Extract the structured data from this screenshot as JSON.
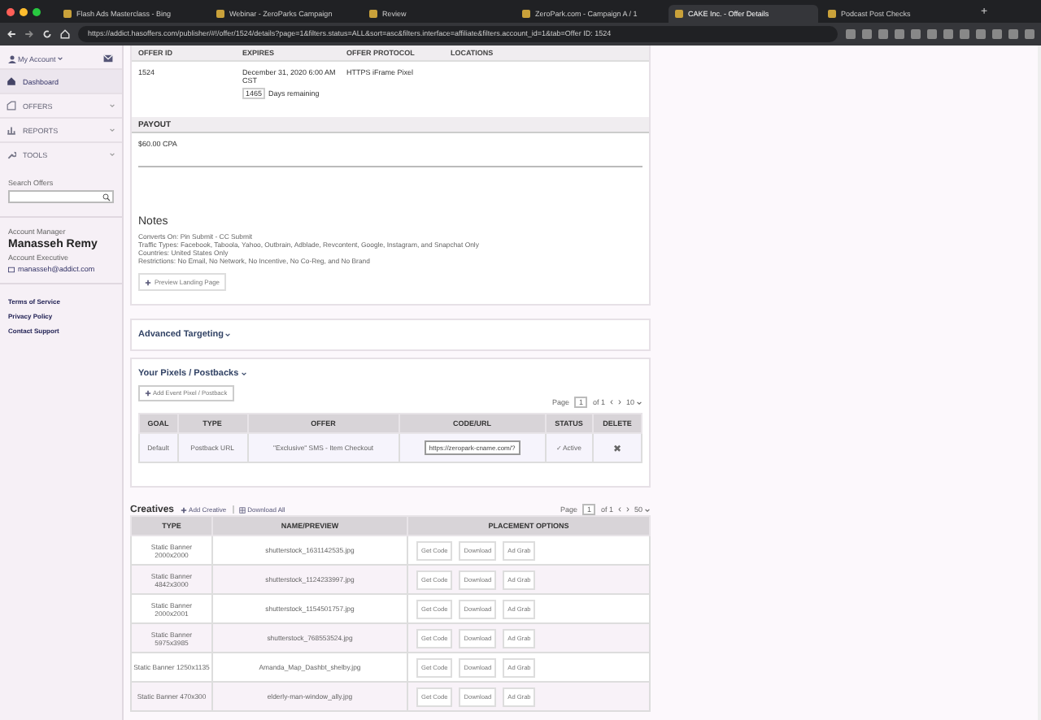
{
  "browser": {
    "tabs": [
      {
        "title": "Flash Ads Masterclass - Bing",
        "selected": false
      },
      {
        "title": "Webinar - ZeroParks Campaign",
        "selected": false
      },
      {
        "title": "Review",
        "selected": false
      },
      {
        "title": "ZeroPark.com - Campaign A / 1",
        "selected": false
      },
      {
        "title": "CAKE Inc. - Offer Details",
        "selected": true
      },
      {
        "title": "Podcast Post Checks",
        "selected": false
      }
    ],
    "new_tab": "+",
    "url": "https://addict.hasoffers.com/publisher/#!/offer/1524/details?page=1&filters.status=ALL&sort=asc&filters.interface=affiliate&filters.account_id=1&tab=Offer ID: 1524"
  },
  "sidebar": {
    "account": "My Account",
    "nav": [
      {
        "label": "Dashboard",
        "kind": "home",
        "expandable": false,
        "selected": true
      },
      {
        "label": "OFFERS",
        "kind": "offers",
        "expandable": true,
        "selected": false
      },
      {
        "label": "REPORTS",
        "kind": "reports",
        "expandable": true,
        "selected": false
      },
      {
        "label": "TOOLS",
        "kind": "tools",
        "expandable": true,
        "selected": false
      }
    ],
    "search_label": "Search Offers",
    "manager": {
      "heading": "Account Manager",
      "name": "Manasseh Remy",
      "title": "Account Executive",
      "email": "manasseh@addict.com"
    },
    "links": [
      "Terms of Service",
      "Privacy Policy",
      "Contact Support"
    ]
  },
  "offer": {
    "columns": [
      "OFFER ID",
      "EXPIRES",
      "OFFER PROTOCOL",
      "LOCATIONS"
    ],
    "offer_id": "1524",
    "expires": "December 31, 2020 6:00 AM CST",
    "days_badge": "1465",
    "days_label": "Days remaining",
    "protocol": "HTTPS iFrame Pixel",
    "payout_heading": "PAYOUT",
    "payout": "$60.00 CPA",
    "notes_heading": "Notes",
    "notes": [
      "Converts On: Pin Submit - CC Submit",
      "Traffic Types: Facebook, Taboola, Yahoo, Outbrain, Adblade, Revcontent, Google, Instagram, and Snapchat Only",
      "Countries: United States Only",
      "Restrictions: No Email, No Network, No Incentive, No Co-Reg, and No Brand"
    ],
    "preview_button": "Preview Landing Page"
  },
  "advanced_targeting": "Advanced Targeting",
  "pixels": {
    "title": "Your Pixels / Postbacks",
    "add_button": "Add Event Pixel / Postback",
    "pagination": {
      "label": "Page",
      "page": "1",
      "of": "of 1",
      "prev": "‹",
      "next": "›",
      "per_page": "10"
    },
    "columns": [
      "GOAL",
      "TYPE",
      "OFFER",
      "CODE/URL",
      "STATUS",
      "DELETE"
    ],
    "rows": [
      {
        "goal": "Default",
        "type": "Postback URL",
        "offer": "\"Exclusive\" SMS - Item Checkout",
        "code": "https://zeropark-cname.com/?",
        "status": "✓ Active",
        "delete": "✖"
      }
    ]
  },
  "creatives": {
    "title": "Creatives",
    "add_button": "Add Creative",
    "download_button": "Download All",
    "pagination": {
      "label": "Page",
      "page": "1",
      "of": "of 1",
      "prev": "‹",
      "next": "›",
      "per_page": "50"
    },
    "columns": [
      "TYPE",
      "NAME/PREVIEW",
      "PLACEMENT OPTIONS"
    ],
    "rows": [
      {
        "type": "Static Banner 2000x2000",
        "name": "shutterstock_1631142535.jpg",
        "buttons": [
          "Get Code",
          "Download",
          "Ad Grab"
        ]
      },
      {
        "type": "Static Banner 4842x3000",
        "name": "shutterstock_1124233997.jpg",
        "buttons": [
          "Get Code",
          "Download",
          "Ad Grab"
        ]
      },
      {
        "type": "Static Banner 2000x2001",
        "name": "shutterstock_1154501757.jpg",
        "buttons": [
          "Get Code",
          "Download",
          "Ad Grab"
        ]
      },
      {
        "type": "Static Banner 5975x3985",
        "name": "shutterstock_768553524.jpg",
        "buttons": [
          "Get Code",
          "Download",
          "Ad Grab"
        ]
      },
      {
        "type": "Static Banner 1250x1135",
        "name": "Amanda_Map_Dashbt_shelby.jpg",
        "buttons": [
          "Get Code",
          "Download",
          "Ad Grab"
        ]
      },
      {
        "type": "Static Banner 470x300",
        "name": "elderly-man-window_ally.jpg",
        "buttons": [
          "Get Code",
          "Download",
          "Ad Grab"
        ]
      }
    ]
  }
}
